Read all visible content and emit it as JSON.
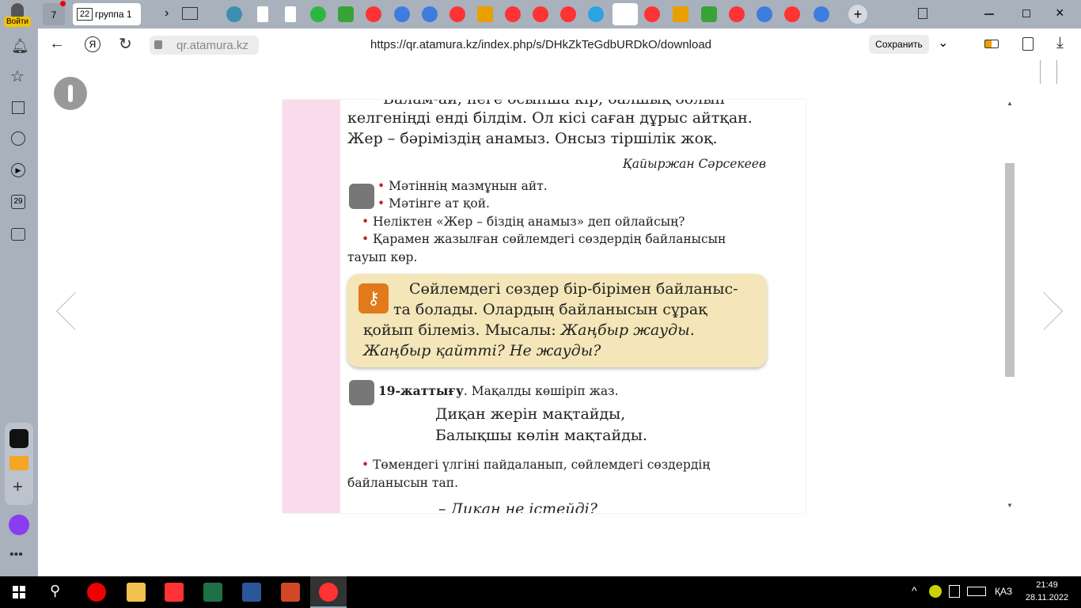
{
  "tabbar": {
    "login_label": "Войти",
    "home_count": "7",
    "active_tab": "группа 1",
    "active_tab_count": "22",
    "new_tab": "+"
  },
  "address": {
    "domain": "qr.atamura.kz",
    "url": "https://qr.atamura.kz/index.php/s/DHkZkTeGdbURDkO/download",
    "save_label": "Сохранить"
  },
  "document": {
    "lines": [
      "Балам-ай, неге осынша кір, балшық болып",
      "келгеніңді енді білдім. Ол кісі саған дұрыс айтқан.",
      "Жер – бәріміздің анамыз. Онсыз тіршілік жоқ."
    ],
    "author": "Қайыржан Сәрсекеев",
    "tasks": [
      "Мәтіннің мазмұнын айт.",
      "Мәтінге ат қой.",
      "Неліктен «Жер – біздің анамыз» деп ойлайсың?",
      "Қарамен жазылған сөйлемдегі сөздердің байланысын",
      "тауып көр."
    ],
    "rule": [
      "Сөйлемдегі сөздер бір-бірімен байланыс-",
      "та болады. Олардың байланысын сұрақ",
      "қойып білеміз. Мысалы: ",
      "Жаңбыр жауды.",
      "Жаңбыр қайтті? Не жауды?"
    ],
    "exercise_num": "19-жаттығу",
    "exercise_text": ". Мақалды көшіріп жаз.",
    "proverb": [
      "Диқан жерін мақтайды,",
      "Балықшы көлін мақтайды."
    ],
    "task2": [
      "Төмендегі үлгіні пайдаланып, сөйлемдегі сөздердің",
      "байланысын тап."
    ],
    "example": "– Диқан не істейді?"
  },
  "taskbar": {
    "time": "21:49",
    "date": "28.11.2022",
    "lang": "ҚАЗ"
  },
  "sidebar": {
    "calendar_day": "29"
  }
}
